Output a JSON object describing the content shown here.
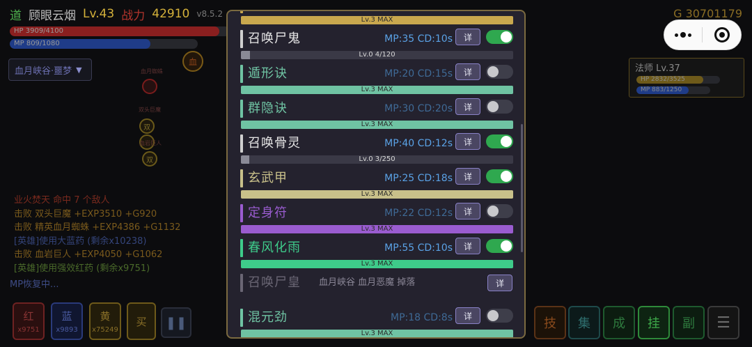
{
  "header": {
    "dao": "道",
    "player_name": "顾眼云烟",
    "level": "Lv.43",
    "power_label": "战力",
    "power_value": "42910",
    "version": "v8.5.2",
    "gold": "G 30701179"
  },
  "player_bars": {
    "hp_text": "HP 3909/4100",
    "hp_fraction": 0.953,
    "mp_text": "MP 809/1080",
    "mp_fraction": 0.749
  },
  "map": {
    "selected": "血月峡谷·噩梦",
    "nodes": [
      "血",
      "血月蜘蛛",
      "双头巨魔",
      "双",
      "血岩巨人",
      "双"
    ]
  },
  "battle_log": [
    {
      "text": "业火焚天 命中 7 个敌人",
      "color": "red"
    },
    {
      "text": "击败 双头巨魔 +EXP3510 +G920",
      "color": "orange"
    },
    {
      "text": "击败 精英血月蜘蛛 +EXP4386 +G1132",
      "color": "orange"
    },
    {
      "text": "[英雄]使用大蓝药 (剩余x10238)",
      "color": "blue"
    },
    {
      "text": "击败 血岩巨人 +EXP4050 +G1062",
      "color": "orange"
    },
    {
      "text": "[英雄]使用强效红药 (剩余x9751)",
      "color": "green"
    }
  ],
  "mp_recover": "MP恢复中...",
  "potions": [
    {
      "label": "红",
      "count": "x9751"
    },
    {
      "label": "蓝",
      "count": "x9893"
    },
    {
      "label": "黄",
      "count": "x75249"
    },
    {
      "label": "买"
    }
  ],
  "action_buttons": [
    "技",
    "集",
    "成",
    "挂",
    "副",
    "☰"
  ],
  "target": {
    "name": "法师 Lv.37",
    "hp_text": "HP 2832/3525",
    "hp_fraction": 0.803,
    "mp_text": "MP 883/1250",
    "mp_fraction": 0.706
  },
  "skills_panel": {
    "detail_label": "详",
    "rows": [
      {
        "name": "",
        "stats": "",
        "bar_text": "Lv.3 MAX",
        "level_fraction": 1.0,
        "color": "#c9a84e",
        "toggle": true,
        "state": "max"
      },
      {
        "name": "召唤尸鬼",
        "stats": "MP:35 CD:10s",
        "bar_text": "Lv.0  4/120",
        "level_fraction": 0.033,
        "color": "#cfcfcf",
        "toggle": true,
        "state": "on"
      },
      {
        "name": "遁形诀",
        "stats": "MP:20 CD:15s",
        "bar_text": "Lv.3 MAX",
        "level_fraction": 1.0,
        "color": "#6fc3a3",
        "toggle": false,
        "state": "max"
      },
      {
        "name": "群隐诀",
        "stats": "MP:30 CD:20s",
        "bar_text": "Lv.3 MAX",
        "level_fraction": 1.0,
        "color": "#6fc3a3",
        "toggle": false,
        "state": "max"
      },
      {
        "name": "召唤骨灵",
        "stats": "MP:40 CD:12s",
        "bar_text": "Lv.0  3/250",
        "level_fraction": 0.012,
        "color": "#cfcfcf",
        "toggle": true,
        "state": "on"
      },
      {
        "name": "玄武甲",
        "stats": "MP:25 CD:18s",
        "bar_text": "Lv.3 MAX",
        "level_fraction": 1.0,
        "color": "#c8c08a",
        "toggle": true,
        "state": "max"
      },
      {
        "name": "定身符",
        "stats": "MP:22 CD:12s",
        "bar_text": "Lv.3 MAX",
        "level_fraction": 1.0,
        "color": "#9a5cd0",
        "toggle": false,
        "state": "max"
      },
      {
        "name": "春风化雨",
        "stats": "MP:55 CD:10s",
        "bar_text": "Lv.3 MAX",
        "level_fraction": 1.0,
        "color": "#3ecb8a",
        "toggle": true,
        "state": "max"
      },
      {
        "name": "召唤尸皇",
        "drop_info": "血月峡谷 血月恶魔 掉落",
        "color": "#6a6674",
        "state": "locked"
      },
      {
        "name": "混元劲",
        "stats": "MP:18 CD:8s",
        "bar_text": "Lv.3 MAX",
        "level_fraction": 1.0,
        "color": "#6fc3a3",
        "toggle": false,
        "state": "max"
      }
    ]
  },
  "wechat_capsule": {
    "more_icon": "more-dots-icon",
    "close_icon": "circle-close-icon"
  }
}
